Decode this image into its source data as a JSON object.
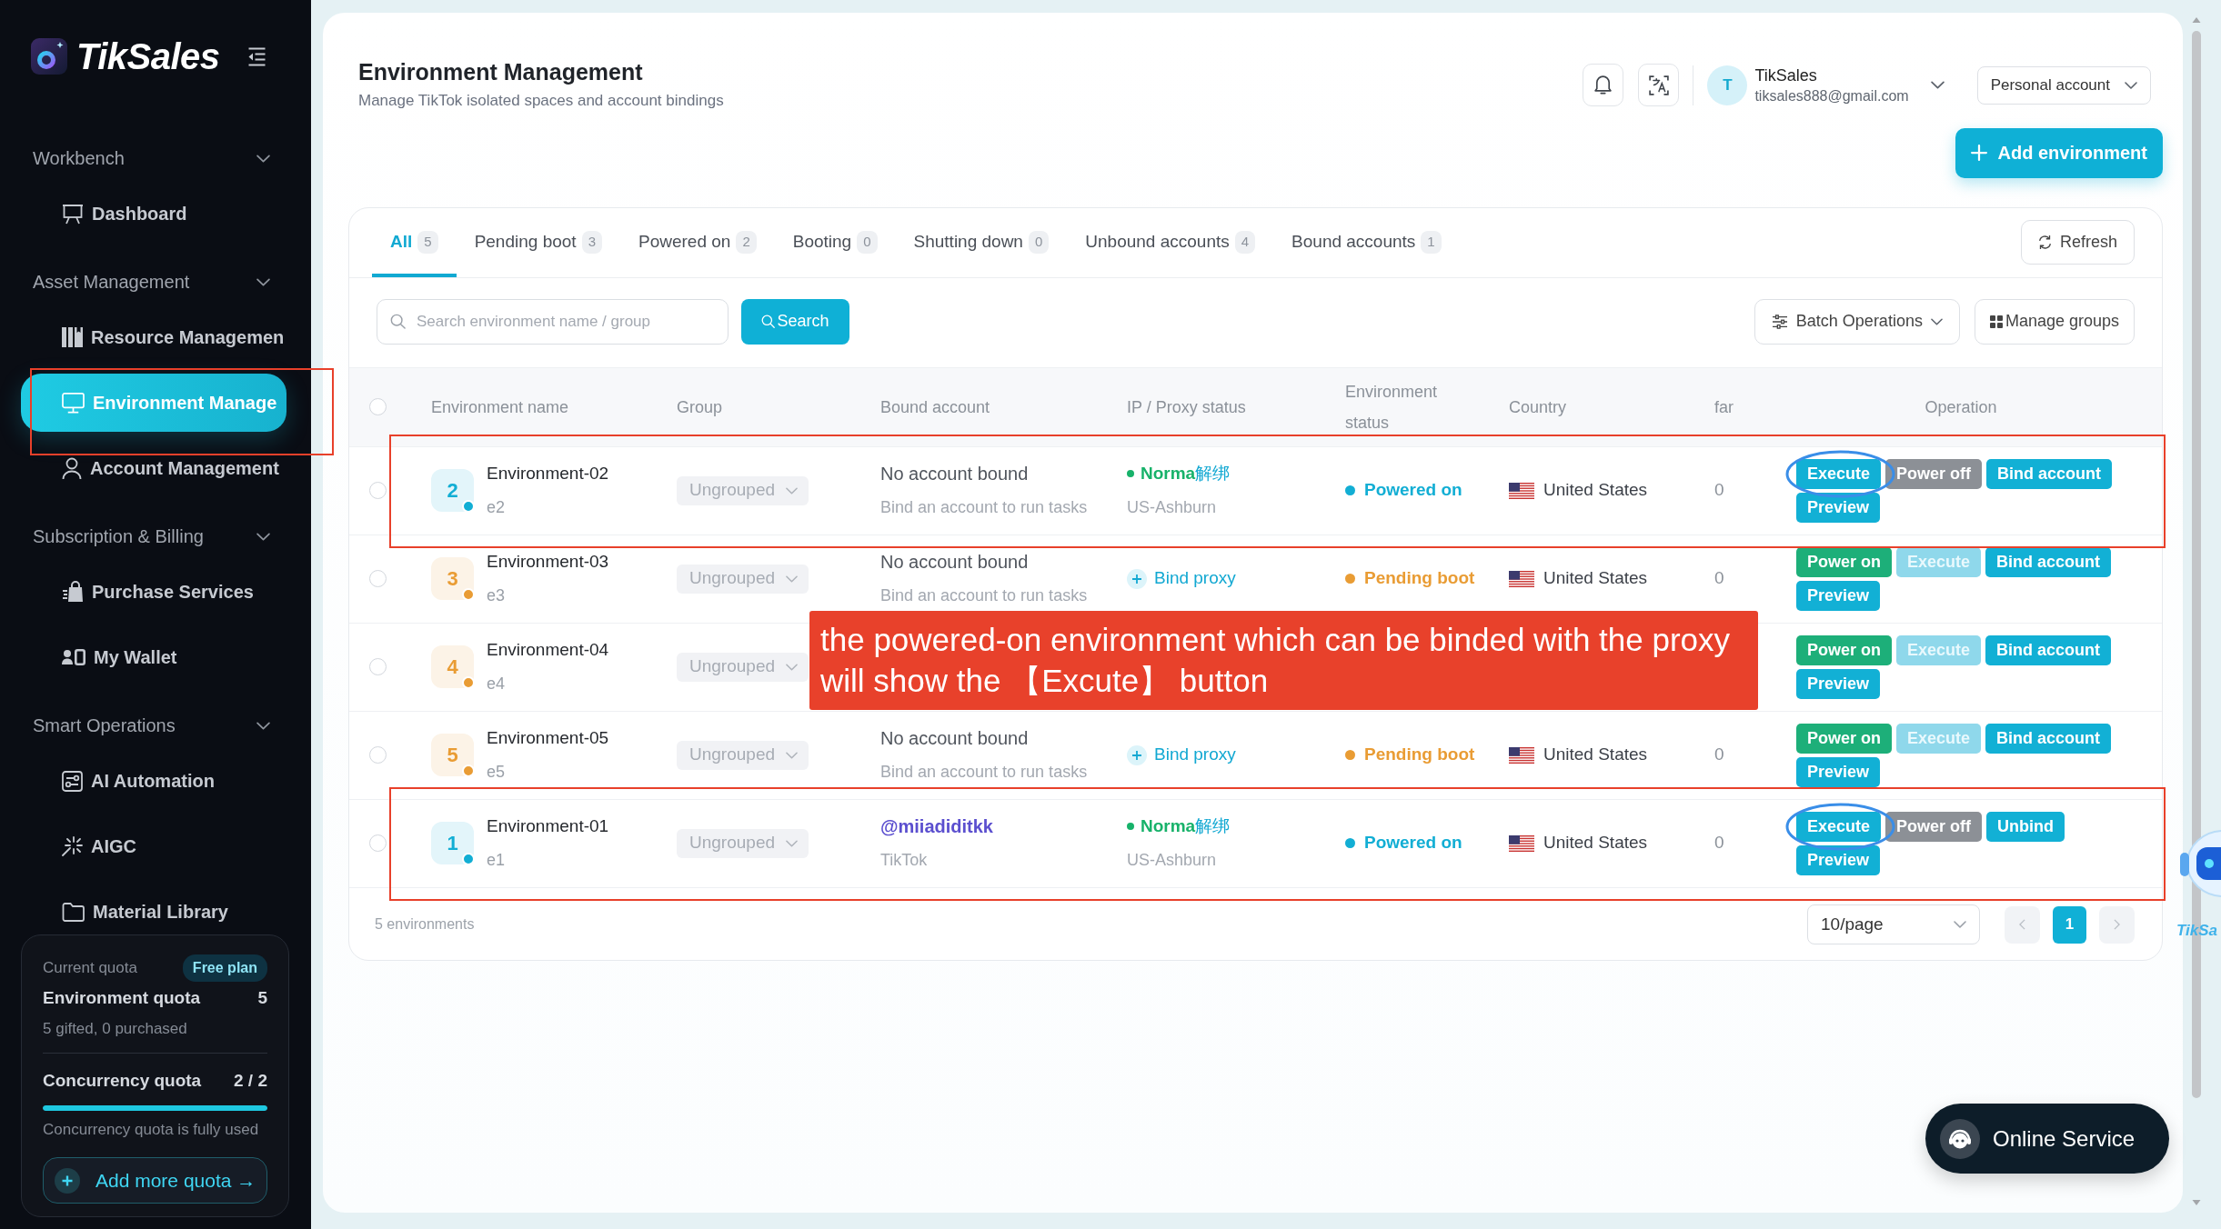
{
  "sidebar": {
    "brand": "TikSales",
    "sections": [
      {
        "title": "Workbench",
        "expanded": true,
        "items": [
          {
            "label": "Dashboard",
            "selected": false,
            "framed": false
          }
        ]
      },
      {
        "title": "Asset Management",
        "expanded": true,
        "items": [
          {
            "label": "Resource Managemen",
            "selected": false,
            "framed": false
          },
          {
            "label": "Environment Manage",
            "selected": true,
            "framed": true
          },
          {
            "label": "Account Management",
            "selected": false,
            "framed": false
          }
        ]
      },
      {
        "title": "Subscription & Billing",
        "expanded": true,
        "items": [
          {
            "label": "Purchase Services",
            "selected": false,
            "framed": false
          },
          {
            "label": "My Wallet",
            "selected": false,
            "framed": false
          }
        ]
      },
      {
        "title": "Smart Operations",
        "expanded": true,
        "items": [
          {
            "label": "AI Automation",
            "selected": false,
            "framed": false
          },
          {
            "label": "AIGC",
            "selected": false,
            "framed": false
          },
          {
            "label": "Material Library",
            "selected": false,
            "framed": false
          }
        ]
      }
    ],
    "quota": {
      "caption": "Current quota",
      "plan": "Free plan",
      "environment": {
        "label": "Environment quota",
        "value": "5",
        "note": "5 gifted, 0 purchased"
      },
      "concurrency": {
        "label": "Concurrency quota",
        "value": "2 / 2",
        "level": 1.0,
        "note": "Concurrency quota is fully used"
      },
      "button": "Add more quota →"
    }
  },
  "header": {
    "title": "Environment Management",
    "subtitle": "Manage TikTok isolated spaces and account bindings",
    "user": {
      "initial": "T",
      "name": "TikSales",
      "email": "tiksales888@gmail.com"
    },
    "account_type": "Personal account",
    "add_button": "Add environment"
  },
  "tabs": [
    {
      "label": "All",
      "count": "5",
      "selected": true
    },
    {
      "label": "Pending boot",
      "count": "3",
      "selected": false
    },
    {
      "label": "Powered on",
      "count": "2",
      "selected": false
    },
    {
      "label": "Booting",
      "count": "0",
      "selected": false
    },
    {
      "label": "Shutting down",
      "count": "0",
      "selected": false
    },
    {
      "label": "Unbound accounts",
      "count": "4",
      "selected": false
    },
    {
      "label": "Bound accounts",
      "count": "1",
      "selected": false
    }
  ],
  "refresh_button": "Refresh",
  "toolbar": {
    "search": {
      "placeholder": "Search environment name / group"
    },
    "search_button": "Search",
    "batch_button": "Batch Operations",
    "groups_button": "Manage groups"
  },
  "table": {
    "select_all": {
      "checked": false
    },
    "columns": [
      "Environment name",
      "Group",
      "Bound account",
      "IP / Proxy status",
      "Environment status",
      "Country",
      "far",
      "Operation"
    ],
    "rows": [
      {
        "checked": false,
        "framed": true,
        "number": "2",
        "color": "#12aed4",
        "name": "Environment-02",
        "code": "e2",
        "group": "Ungrouped",
        "account": {
          "kind": "none",
          "name": "No account bound",
          "note": "Bind an account to run tasks"
        },
        "proxy": {
          "kind": "status",
          "status": "Norma",
          "action": "解绑",
          "location": "US-Ashburn"
        },
        "status": "Powered on",
        "country": "United States",
        "far": "0",
        "actions": [
          {
            "label": "Execute",
            "kind": "primary",
            "disabled": false,
            "circled": true
          },
          {
            "label": "Power off",
            "kind": "secondary",
            "disabled": false,
            "circled": false
          },
          {
            "label": "Bind account",
            "kind": "primary",
            "disabled": false,
            "circled": false
          },
          {
            "label": "Preview",
            "kind": "primary",
            "disabled": false,
            "circled": false
          }
        ]
      },
      {
        "checked": false,
        "framed": false,
        "number": "3",
        "color": "#e99c34",
        "name": "Environment-03",
        "code": "e3",
        "group": "Ungrouped",
        "account": {
          "kind": "none",
          "name": "No account bound",
          "note": "Bind an account to run tasks"
        },
        "proxy": {
          "kind": "bind",
          "label": "Bind proxy"
        },
        "status": "Pending boot",
        "country": "United States",
        "far": "0",
        "actions": [
          {
            "label": "Power on",
            "kind": "success",
            "disabled": false,
            "circled": false
          },
          {
            "label": "Execute",
            "kind": "primary",
            "disabled": true,
            "circled": false
          },
          {
            "label": "Bind account",
            "kind": "primary",
            "disabled": false,
            "circled": false
          },
          {
            "label": "Preview",
            "kind": "primary",
            "disabled": false,
            "circled": false
          }
        ]
      },
      {
        "checked": false,
        "framed": false,
        "number": "4",
        "color": "#e99c34",
        "name": "Environment-04",
        "code": "e4",
        "group": "Ungrouped",
        "actions": [
          {
            "label": "Power on",
            "kind": "success",
            "disabled": false,
            "circled": false
          },
          {
            "label": "Execute",
            "kind": "primary",
            "disabled": true,
            "circled": false
          },
          {
            "label": "Bind account",
            "kind": "primary",
            "disabled": false,
            "circled": false
          },
          {
            "label": "Preview",
            "kind": "primary",
            "disabled": false,
            "circled": false
          }
        ]
      },
      {
        "checked": false,
        "framed": false,
        "number": "5",
        "color": "#e99c34",
        "name": "Environment-05",
        "code": "e5",
        "group": "Ungrouped",
        "account": {
          "kind": "none",
          "name": "No account bound",
          "note": "Bind an account to run tasks"
        },
        "proxy": {
          "kind": "bind",
          "label": "Bind proxy"
        },
        "status": "Pending boot",
        "country": "United States",
        "far": "0",
        "actions": [
          {
            "label": "Power on",
            "kind": "success",
            "disabled": false,
            "circled": false
          },
          {
            "label": "Execute",
            "kind": "primary",
            "disabled": true,
            "circled": false
          },
          {
            "label": "Bind account",
            "kind": "primary",
            "disabled": false,
            "circled": false
          },
          {
            "label": "Preview",
            "kind": "primary",
            "disabled": false,
            "circled": false
          }
        ]
      },
      {
        "checked": false,
        "framed": true,
        "number": "1",
        "color": "#12aed4",
        "name": "Environment-01",
        "code": "e1",
        "group": "Ungrouped",
        "account": {
          "kind": "linked",
          "name": "@miiadiditkk",
          "note": "TikTok"
        },
        "proxy": {
          "kind": "status",
          "status": "Norma",
          "action": "解绑",
          "location": "US-Ashburn"
        },
        "status": "Powered on",
        "country": "United States",
        "far": "0",
        "actions": [
          {
            "label": "Execute",
            "kind": "primary",
            "disabled": false,
            "circled": true
          },
          {
            "label": "Power off",
            "kind": "secondary",
            "disabled": false,
            "circled": false
          },
          {
            "label": "Unbind",
            "kind": "primary",
            "disabled": false,
            "circled": false
          },
          {
            "label": "Preview",
            "kind": "primary",
            "disabled": false,
            "circled": false
          }
        ]
      }
    ]
  },
  "footer": {
    "total": "5 environments",
    "page_size": "10/page",
    "pages": [
      {
        "label": "1",
        "selected": true
      }
    ]
  },
  "annotation": {
    "callout": "the powered-on environment which can be binded with the proxy will show the 【Excute】 button"
  },
  "online_service": "Online Service",
  "assistant": {
    "label": "TikSa"
  }
}
